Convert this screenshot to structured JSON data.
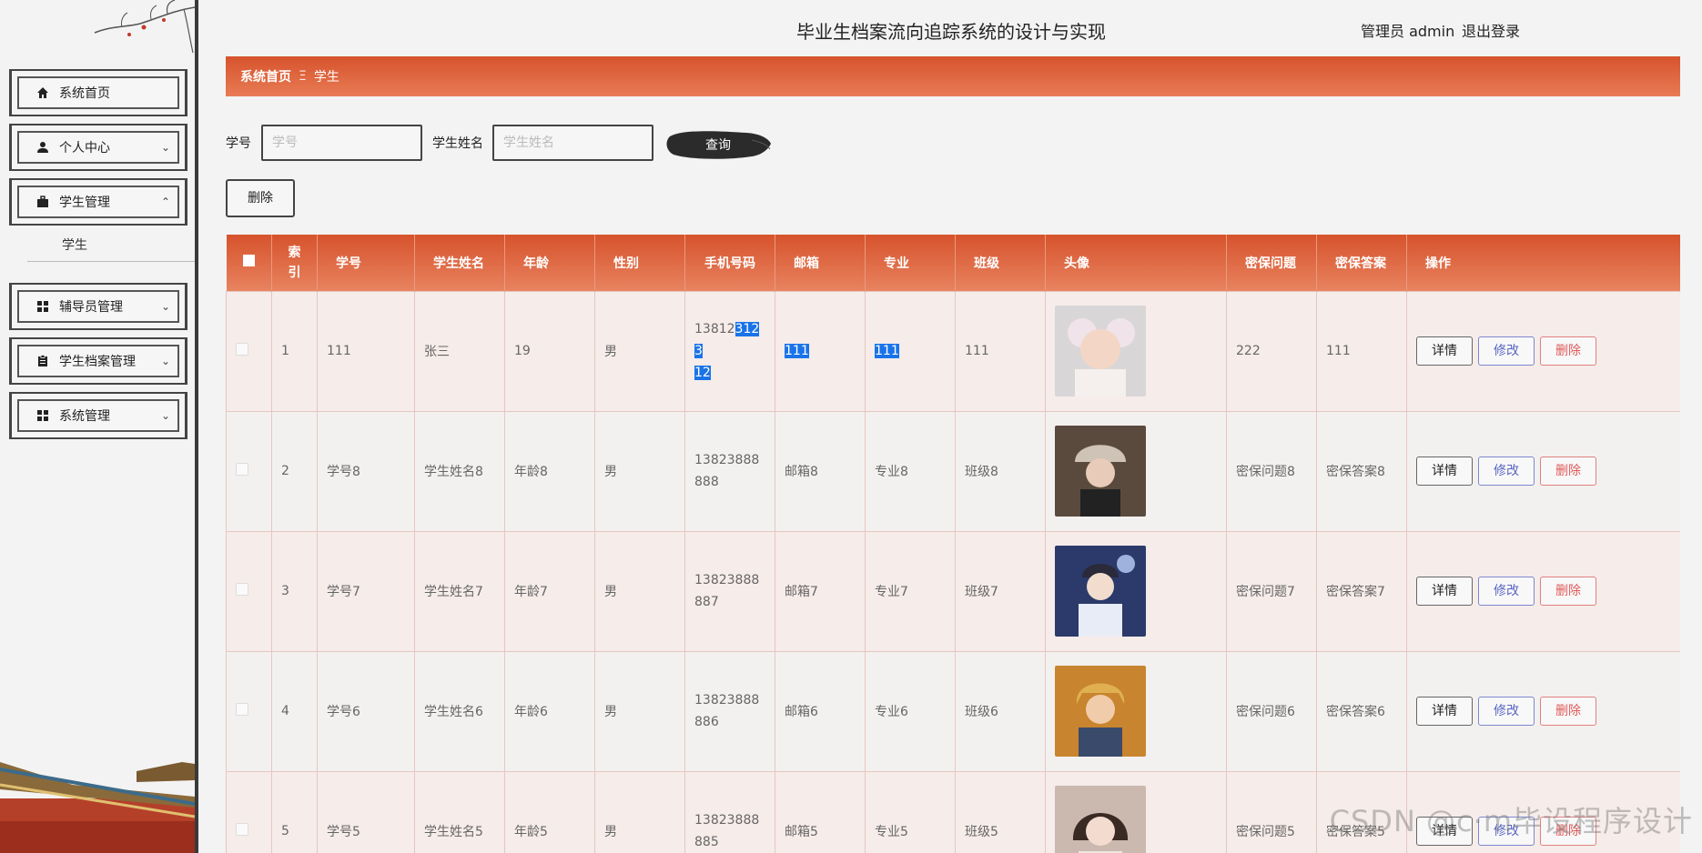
{
  "header": {
    "title": "毕业生档案流向追踪系统的设计与实现",
    "user": "管理员 admin",
    "logout": "退出登录"
  },
  "sidebar": {
    "items": [
      {
        "label": "系统首页",
        "icon": "home-icon"
      },
      {
        "label": "个人中心",
        "icon": "user-icon"
      },
      {
        "label": "学生管理",
        "icon": "briefcase-icon"
      },
      {
        "label": "辅导员管理",
        "icon": "grid-icon"
      },
      {
        "label": "学生档案管理",
        "icon": "clipboard-icon"
      },
      {
        "label": "系统管理",
        "icon": "grid-icon"
      }
    ],
    "submenu": "学生"
  },
  "breadcrumb": {
    "home": "系统首页",
    "separator": "Ξ",
    "current": "学生"
  },
  "search": {
    "id_label": "学号",
    "id_placeholder": "学号",
    "name_label": "学生姓名",
    "name_placeholder": "学生姓名",
    "query": "查询",
    "delete": "删除"
  },
  "table": {
    "headers": [
      "索引",
      "学号",
      "学生姓名",
      "年龄",
      "性别",
      "手机号码",
      "邮箱",
      "专业",
      "班级",
      "头像",
      "密保问题",
      "密保答案",
      "操作"
    ],
    "rows": [
      {
        "idx": "1",
        "sid": "111",
        "name": "张三",
        "age": "19",
        "sex": "男",
        "phone_a": "13812",
        "phone_b": "3123",
        "phone_c": "12",
        "email": "111",
        "major": "111",
        "cls": "111",
        "q": "222",
        "a": "111"
      },
      {
        "idx": "2",
        "sid": "学号8",
        "name": "学生姓名8",
        "age": "年龄8",
        "sex": "男",
        "phone": "13823888888",
        "email": "邮箱8",
        "major": "专业8",
        "cls": "班级8",
        "q": "密保问题8",
        "a": "密保答案8"
      },
      {
        "idx": "3",
        "sid": "学号7",
        "name": "学生姓名7",
        "age": "年龄7",
        "sex": "男",
        "phone": "13823888887",
        "email": "邮箱7",
        "major": "专业7",
        "cls": "班级7",
        "q": "密保问题7",
        "a": "密保答案7"
      },
      {
        "idx": "4",
        "sid": "学号6",
        "name": "学生姓名6",
        "age": "年龄6",
        "sex": "男",
        "phone": "13823888886",
        "email": "邮箱6",
        "major": "专业6",
        "cls": "班级6",
        "q": "密保问题6",
        "a": "密保答案6"
      },
      {
        "idx": "5",
        "sid": "学号5",
        "name": "学生姓名5",
        "age": "年龄5",
        "sex": "男",
        "phone": "13823888885",
        "email": "邮箱5",
        "major": "专业5",
        "cls": "班级5",
        "q": "密保问题5",
        "a": "密保答案5"
      }
    ],
    "actions": {
      "detail": "详情",
      "edit": "修改",
      "delete": "删除"
    }
  },
  "watermark": "CSDN @c·m毕设程序设计",
  "colors": {
    "accent": "#d6532c",
    "accent_light": "#e87b55",
    "highlight": "#1a73e8"
  }
}
